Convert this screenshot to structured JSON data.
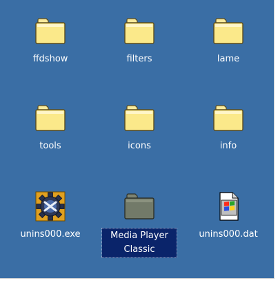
{
  "window": {
    "background": "#3a6ea5",
    "selection_color": "#0a246a"
  },
  "items": [
    {
      "label": "ffdshow",
      "icon": "folder-icon"
    },
    {
      "label": "filters",
      "icon": "folder-icon"
    },
    {
      "label": "lame",
      "icon": "folder-icon"
    },
    {
      "label": "tools",
      "icon": "folder-icon"
    },
    {
      "label": "icons",
      "icon": "folder-icon"
    },
    {
      "label": "info",
      "icon": "folder-icon"
    },
    {
      "label": "unins000.exe",
      "icon": "uninstaller-gear-icon"
    },
    {
      "label": "Media Player Classic",
      "icon": "folder-icon",
      "selected": true
    },
    {
      "label": "unins000.dat",
      "icon": "windows-file-icon"
    }
  ]
}
